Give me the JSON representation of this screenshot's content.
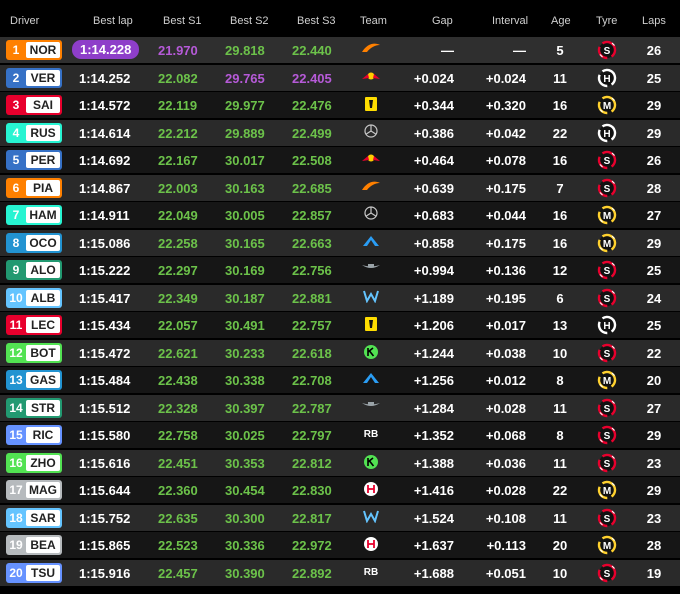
{
  "headers": {
    "driver": "Driver",
    "best_lap": "Best lap",
    "best_s1": "Best S1",
    "best_s2": "Best S2",
    "best_s3": "Best S3",
    "team": "Team",
    "gap": "Gap",
    "interval": "Interval",
    "age": "Age",
    "tyre": "Tyre",
    "laps": "Laps"
  },
  "rows": [
    {
      "pos": "1",
      "code": "NOR",
      "color": "#ff8000",
      "best_lap": "1:14.228",
      "s1": "21.970",
      "s2": "29.818",
      "s3": "22.440",
      "s1_c": "purple",
      "s2_c": "green",
      "s3_c": "green",
      "team": "mclaren-icon",
      "gap": "—",
      "interval": "—",
      "age": "5",
      "tyre": "S",
      "tyre_color": "#e8002d",
      "laps": "26"
    },
    {
      "pos": "2",
      "code": "VER",
      "color": "#3671c6",
      "best_lap": "1:14.252",
      "s1": "22.082",
      "s2": "29.765",
      "s3": "22.405",
      "s1_c": "green",
      "s2_c": "purple",
      "s3_c": "purple",
      "team": "red-bull-icon",
      "gap": "+0.024",
      "interval": "+0.024",
      "age": "11",
      "tyre": "H",
      "tyre_color": "#ffffff",
      "laps": "25"
    },
    {
      "pos": "3",
      "code": "SAI",
      "color": "#e8002d",
      "best_lap": "1:14.572",
      "s1": "22.119",
      "s2": "29.977",
      "s3": "22.476",
      "s1_c": "green",
      "s2_c": "green",
      "s3_c": "green",
      "team": "ferrari-icon",
      "gap": "+0.344",
      "interval": "+0.320",
      "age": "16",
      "tyre": "M",
      "tyre_color": "#ffd12e",
      "laps": "29"
    },
    {
      "pos": "4",
      "code": "RUS",
      "color": "#27f4d2",
      "best_lap": "1:14.614",
      "s1": "22.212",
      "s2": "29.889",
      "s3": "22.499",
      "s1_c": "green",
      "s2_c": "green",
      "s3_c": "green",
      "team": "mercedes-icon",
      "gap": "+0.386",
      "interval": "+0.042",
      "age": "22",
      "tyre": "H",
      "tyre_color": "#ffffff",
      "laps": "29"
    },
    {
      "pos": "5",
      "code": "PER",
      "color": "#3671c6",
      "best_lap": "1:14.692",
      "s1": "22.167",
      "s2": "30.017",
      "s3": "22.508",
      "s1_c": "green",
      "s2_c": "green",
      "s3_c": "green",
      "team": "red-bull-icon",
      "gap": "+0.464",
      "interval": "+0.078",
      "age": "16",
      "tyre": "S",
      "tyre_color": "#e8002d",
      "laps": "26"
    },
    {
      "pos": "6",
      "code": "PIA",
      "color": "#ff8000",
      "best_lap": "1:14.867",
      "s1": "22.003",
      "s2": "30.163",
      "s3": "22.685",
      "s1_c": "green",
      "s2_c": "green",
      "s3_c": "green",
      "team": "mclaren-icon",
      "gap": "+0.639",
      "interval": "+0.175",
      "age": "7",
      "tyre": "S",
      "tyre_color": "#e8002d",
      "laps": "28"
    },
    {
      "pos": "7",
      "code": "HAM",
      "color": "#27f4d2",
      "best_lap": "1:14.911",
      "s1": "22.049",
      "s2": "30.005",
      "s3": "22.857",
      "s1_c": "green",
      "s2_c": "green",
      "s3_c": "green",
      "team": "mercedes-icon",
      "gap": "+0.683",
      "interval": "+0.044",
      "age": "16",
      "tyre": "M",
      "tyre_color": "#ffd12e",
      "laps": "27"
    },
    {
      "pos": "8",
      "code": "OCO",
      "color": "#2293d1",
      "best_lap": "1:15.086",
      "s1": "22.258",
      "s2": "30.165",
      "s3": "22.663",
      "s1_c": "green",
      "s2_c": "green",
      "s3_c": "green",
      "team": "alpine-icon",
      "gap": "+0.858",
      "interval": "+0.175",
      "age": "16",
      "tyre": "M",
      "tyre_color": "#ffd12e",
      "laps": "29"
    },
    {
      "pos": "9",
      "code": "ALO",
      "color": "#229971",
      "best_lap": "1:15.222",
      "s1": "22.297",
      "s2": "30.169",
      "s3": "22.756",
      "s1_c": "green",
      "s2_c": "green",
      "s3_c": "green",
      "team": "aston-martin-icon",
      "gap": "+0.994",
      "interval": "+0.136",
      "age": "12",
      "tyre": "S",
      "tyre_color": "#e8002d",
      "laps": "25"
    },
    {
      "pos": "10",
      "code": "ALB",
      "color": "#64c4ff",
      "best_lap": "1:15.417",
      "s1": "22.349",
      "s2": "30.187",
      "s3": "22.881",
      "s1_c": "green",
      "s2_c": "green",
      "s3_c": "green",
      "team": "williams-icon",
      "gap": "+1.189",
      "interval": "+0.195",
      "age": "6",
      "tyre": "S",
      "tyre_color": "#e8002d",
      "laps": "24"
    },
    {
      "pos": "11",
      "code": "LEC",
      "color": "#e8002d",
      "best_lap": "1:15.434",
      "s1": "22.057",
      "s2": "30.491",
      "s3": "22.757",
      "s1_c": "green",
      "s2_c": "green",
      "s3_c": "green",
      "team": "ferrari-icon",
      "gap": "+1.206",
      "interval": "+0.017",
      "age": "13",
      "tyre": "H",
      "tyre_color": "#ffffff",
      "laps": "25"
    },
    {
      "pos": "12",
      "code": "BOT",
      "color": "#52e252",
      "best_lap": "1:15.472",
      "s1": "22.621",
      "s2": "30.233",
      "s3": "22.618",
      "s1_c": "green",
      "s2_c": "green",
      "s3_c": "green",
      "team": "kick-sauber-icon",
      "gap": "+1.244",
      "interval": "+0.038",
      "age": "10",
      "tyre": "S",
      "tyre_color": "#e8002d",
      "laps": "22"
    },
    {
      "pos": "13",
      "code": "GAS",
      "color": "#2293d1",
      "best_lap": "1:15.484",
      "s1": "22.438",
      "s2": "30.338",
      "s3": "22.708",
      "s1_c": "green",
      "s2_c": "green",
      "s3_c": "green",
      "team": "alpine-icon",
      "gap": "+1.256",
      "interval": "+0.012",
      "age": "8",
      "tyre": "M",
      "tyre_color": "#ffd12e",
      "laps": "20"
    },
    {
      "pos": "14",
      "code": "STR",
      "color": "#229971",
      "best_lap": "1:15.512",
      "s1": "22.328",
      "s2": "30.397",
      "s3": "22.787",
      "s1_c": "green",
      "s2_c": "green",
      "s3_c": "green",
      "team": "aston-martin-icon",
      "gap": "+1.284",
      "interval": "+0.028",
      "age": "11",
      "tyre": "S",
      "tyre_color": "#e8002d",
      "laps": "27"
    },
    {
      "pos": "15",
      "code": "RIC",
      "color": "#6692ff",
      "best_lap": "1:15.580",
      "s1": "22.758",
      "s2": "30.025",
      "s3": "22.797",
      "s1_c": "green",
      "s2_c": "green",
      "s3_c": "green",
      "team": "rb-icon",
      "gap": "+1.352",
      "interval": "+0.068",
      "age": "8",
      "tyre": "S",
      "tyre_color": "#e8002d",
      "laps": "29"
    },
    {
      "pos": "16",
      "code": "ZHO",
      "color": "#52e252",
      "best_lap": "1:15.616",
      "s1": "22.451",
      "s2": "30.353",
      "s3": "22.812",
      "s1_c": "green",
      "s2_c": "green",
      "s3_c": "green",
      "team": "kick-sauber-icon",
      "gap": "+1.388",
      "interval": "+0.036",
      "age": "11",
      "tyre": "S",
      "tyre_color": "#e8002d",
      "laps": "23"
    },
    {
      "pos": "17",
      "code": "MAG",
      "color": "#b6babd",
      "best_lap": "1:15.644",
      "s1": "22.360",
      "s2": "30.454",
      "s3": "22.830",
      "s1_c": "green",
      "s2_c": "green",
      "s3_c": "green",
      "team": "haas-icon",
      "gap": "+1.416",
      "interval": "+0.028",
      "age": "22",
      "tyre": "M",
      "tyre_color": "#ffd12e",
      "laps": "29"
    },
    {
      "pos": "18",
      "code": "SAR",
      "color": "#64c4ff",
      "best_lap": "1:15.752",
      "s1": "22.635",
      "s2": "30.300",
      "s3": "22.817",
      "s1_c": "green",
      "s2_c": "green",
      "s3_c": "green",
      "team": "williams-icon",
      "gap": "+1.524",
      "interval": "+0.108",
      "age": "11",
      "tyre": "S",
      "tyre_color": "#e8002d",
      "laps": "23"
    },
    {
      "pos": "19",
      "code": "BEA",
      "color": "#b6babd",
      "best_lap": "1:15.865",
      "s1": "22.523",
      "s2": "30.336",
      "s3": "22.972",
      "s1_c": "green",
      "s2_c": "green",
      "s3_c": "green",
      "team": "haas-icon",
      "gap": "+1.637",
      "interval": "+0.113",
      "age": "20",
      "tyre": "M",
      "tyre_color": "#ffd12e",
      "laps": "28"
    },
    {
      "pos": "20",
      "code": "TSU",
      "color": "#6692ff",
      "best_lap": "1:15.916",
      "s1": "22.457",
      "s2": "30.390",
      "s3": "22.892",
      "s1_c": "green",
      "s2_c": "green",
      "s3_c": "green",
      "team": "rb-icon",
      "gap": "+1.688",
      "interval": "+0.051",
      "age": "10",
      "tyre": "S",
      "tyre_color": "#e8002d",
      "laps": "19"
    }
  ]
}
